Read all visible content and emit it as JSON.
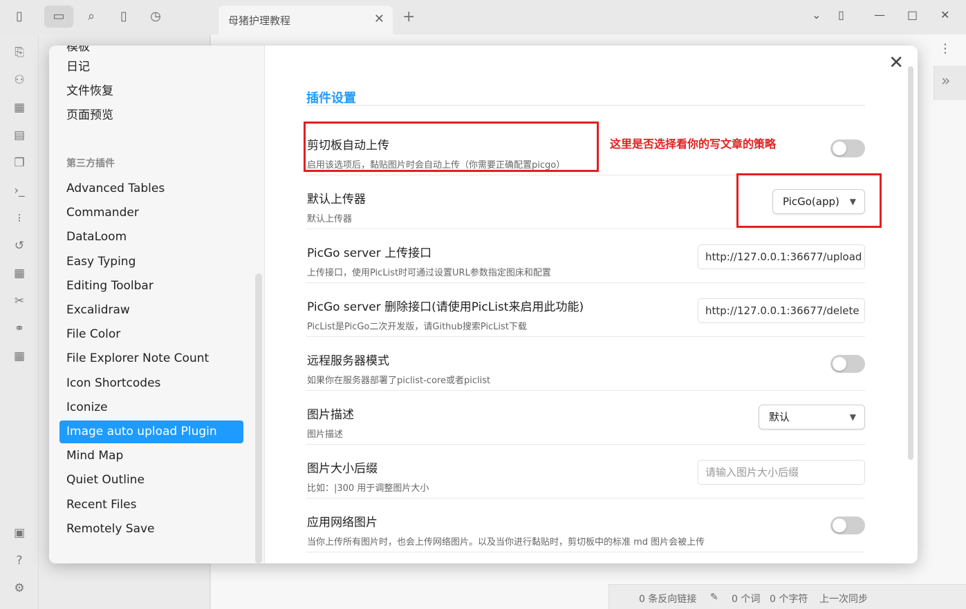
{
  "tab": {
    "title": "母猪护理教程"
  },
  "sidebar": {
    "top_items": [
      "模板",
      "日记",
      "文件恢复",
      "页面预览"
    ],
    "heading": "第三方插件",
    "plugins": [
      "Advanced Tables",
      "Commander",
      "DataLoom",
      "Easy Typing",
      "Editing Toolbar",
      "Excalidraw",
      "File Color",
      "File Explorer Note Count",
      "Icon Shortcodes",
      "Iconize",
      "Image auto upload Plugin",
      "Mind Map",
      "Quiet Outline",
      "Recent Files",
      "Remotely Save"
    ],
    "active": "Image auto upload Plugin"
  },
  "content": {
    "section_title": "插件设置",
    "annotation": "这里是否选择看你的写文章的策略",
    "settings": [
      {
        "name": "剪切板自动上传",
        "desc": "启用该选项后，黏贴图片时会自动上传（你需要正确配置picgo）",
        "control": "toggle",
        "on": false
      },
      {
        "name": "默认上传器",
        "desc": "默认上传器",
        "control": "select",
        "value": "PicGo(app)"
      },
      {
        "name": "PicGo server 上传接口",
        "desc": "上传接口，使用PicList时可通过设置URL参数指定图床和配置",
        "control": "input",
        "value": "http://127.0.0.1:36677/upload"
      },
      {
        "name": "PicGo server 删除接口(请使用PicList来启用此功能)",
        "desc": "PicList是PicGo二次开发版，请Github搜索PicList下载",
        "control": "input",
        "value": "http://127.0.0.1:36677/delete"
      },
      {
        "name": "远程服务器模式",
        "desc": "如果你在服务器部署了piclist-core或者piclist",
        "control": "toggle",
        "on": false
      },
      {
        "name": "图片描述",
        "desc": "图片描述",
        "control": "select",
        "value": "默认"
      },
      {
        "name": "图片大小后缀",
        "desc": "比如：|300 用于调整图片大小",
        "control": "input",
        "placeholder": "请输入图片大小后缀"
      },
      {
        "name": "应用网络图片",
        "desc": "当你上传所有图片时，也会上传网络图片。以及当你进行黏贴时，剪切板中的标准 md 图片会被上传",
        "control": "toggle",
        "on": false
      }
    ]
  },
  "statusbar": {
    "backlinks": "0 条反向链接",
    "words": "0 个词",
    "chars": "0 个字符",
    "last": "上一次同步"
  },
  "colors": {
    "accent": "#1e9bff",
    "annotation_red": "#e02020"
  }
}
